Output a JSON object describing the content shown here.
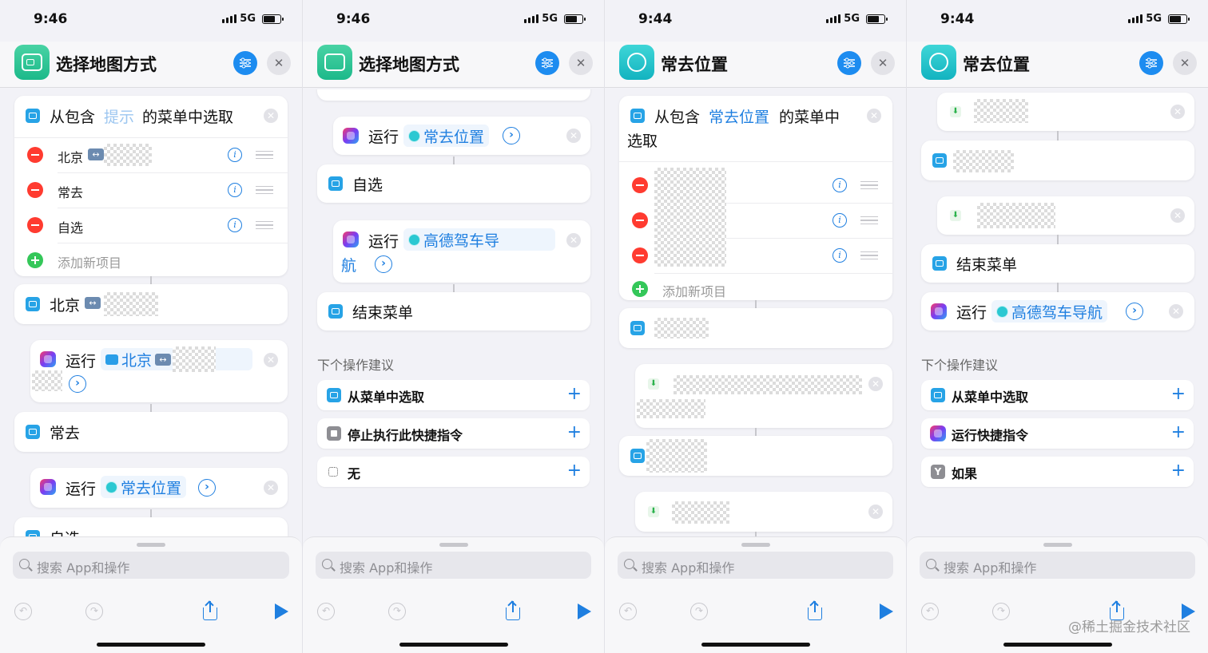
{
  "watermark": "@稀土掘金技术社区",
  "bottom": {
    "search_placeholder": "搜索 App和操作"
  },
  "phones": [
    {
      "time": "9:46",
      "network": "5G",
      "title": "选择地图方式",
      "menu": {
        "prefix": "从包含",
        "placeholder": "提示",
        "suffix": "的菜单中选取",
        "items": [
          "北京",
          "常去",
          "自选"
        ],
        "add_label": "添加新项目"
      },
      "case1_label": "北京",
      "run1": {
        "verb": "运行",
        "target": "北京"
      },
      "case2_label": "常去",
      "run2": {
        "verb": "运行",
        "target": "常去位置"
      },
      "case3_label": "自选"
    },
    {
      "time": "9:46",
      "network": "5G",
      "title": "选择地图方式",
      "run1": {
        "verb": "运行",
        "target": "常去位置"
      },
      "case_label": "自选",
      "run2": {
        "verb": "运行",
        "target_line1": "高德驾车导",
        "target_line2": "航"
      },
      "end_label": "结束菜单",
      "suggest_title": "下个操作建议",
      "suggestions": [
        "从菜单中选取",
        "停止执行此快捷指令",
        "无"
      ]
    },
    {
      "time": "9:44",
      "network": "5G",
      "title": "常去位置",
      "menu": {
        "prefix": "从包含",
        "placeholder": "常去位置",
        "suffix": "的菜单中",
        "line2": "选取",
        "add_label": "添加新项目"
      }
    },
    {
      "time": "9:44",
      "network": "5G",
      "title": "常去位置",
      "end_label": "结束菜单",
      "run": {
        "verb": "运行",
        "target": "高德驾车导航"
      },
      "suggest_title": "下个操作建议",
      "suggestions": [
        "从菜单中选取",
        "运行快捷指令",
        "如果"
      ]
    }
  ]
}
